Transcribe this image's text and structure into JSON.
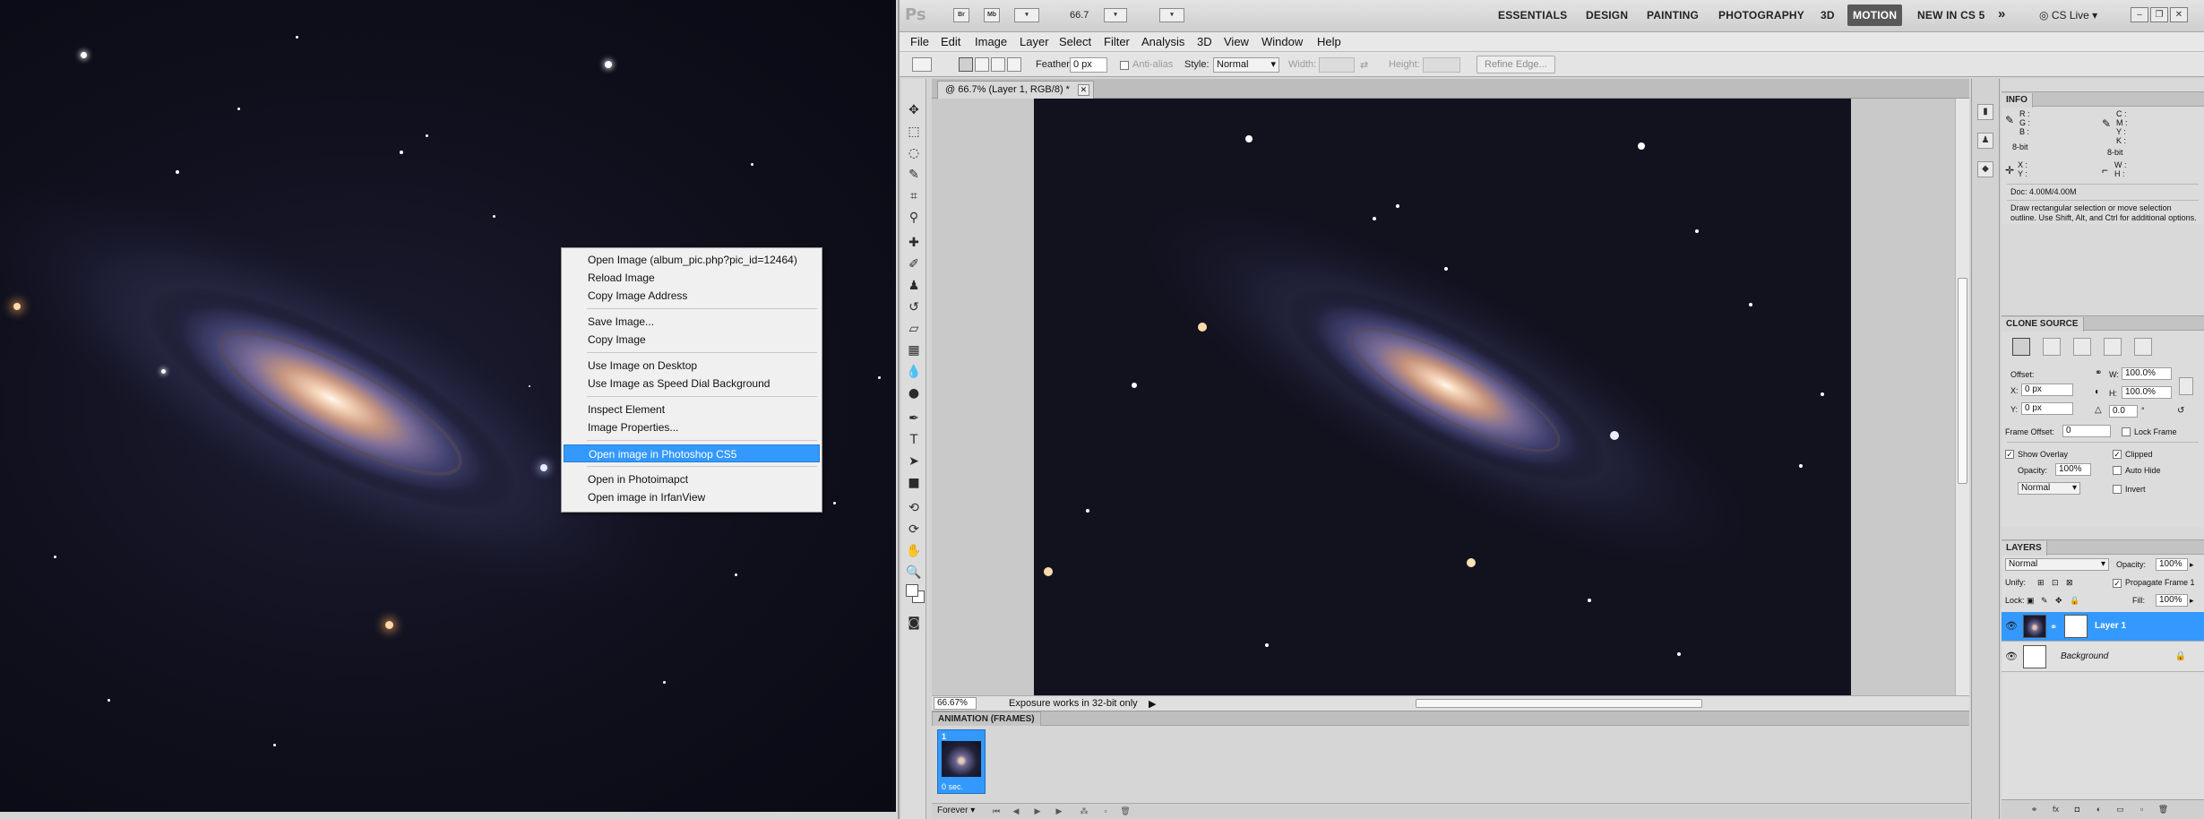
{
  "context_menu": {
    "items": [
      {
        "label": "Open Image (album_pic.php?pic_id=12464)",
        "highlighted": false,
        "sep_after": false
      },
      {
        "label": "Reload Image",
        "highlighted": false,
        "sep_after": false
      },
      {
        "label": "Copy Image Address",
        "highlighted": false,
        "sep_after": true
      },
      {
        "label": "Save Image...",
        "highlighted": false,
        "sep_after": false
      },
      {
        "label": "Copy Image",
        "highlighted": false,
        "sep_after": true
      },
      {
        "label": "Use Image on Desktop",
        "highlighted": false,
        "sep_after": false
      },
      {
        "label": "Use Image as Speed Dial Background",
        "highlighted": false,
        "sep_after": true
      },
      {
        "label": "Inspect Element",
        "highlighted": false,
        "sep_after": false
      },
      {
        "label": "Image Properties...",
        "highlighted": false,
        "sep_after": true
      },
      {
        "label": "Open image in Photoshop CS5",
        "highlighted": true,
        "sep_after": true
      },
      {
        "label": "Open in Photoimapct",
        "highlighted": false,
        "sep_after": false
      },
      {
        "label": "Open image in IrfanView",
        "highlighted": false,
        "sep_after": false
      }
    ]
  },
  "photoshop": {
    "logo": "Ps",
    "appbar_buttons": [
      "Br",
      "Mb"
    ],
    "zoom": "66.7",
    "workspaces": [
      {
        "label": "ESSENTIALS",
        "active": false
      },
      {
        "label": "DESIGN",
        "active": false
      },
      {
        "label": "PAINTING",
        "active": false
      },
      {
        "label": "PHOTOGRAPHY",
        "active": false
      },
      {
        "label": "3D",
        "active": false
      },
      {
        "label": "MOTION",
        "active": true
      },
      {
        "label": "NEW IN CS 5",
        "active": false
      }
    ],
    "workspace_more": "»",
    "cs_live": "CS Live",
    "window_controls": [
      "–",
      "❐",
      "✕"
    ],
    "menus": [
      "File",
      "Edit",
      "Image",
      "Layer",
      "Select",
      "Filter",
      "Analysis",
      "3D",
      "View",
      "Window",
      "Help"
    ],
    "options": {
      "feather_label": "Feather:",
      "feather_value": "0 px",
      "antialias_label": "Anti-alias",
      "style_label": "Style:",
      "style_value": "Normal",
      "width_label": "Width:",
      "height_label": "Height:",
      "refine_edge": "Refine Edge..."
    },
    "document": {
      "tab_title": "@ 66.7% (Layer 1, RGB/8) *",
      "zoom_status": "66.67%",
      "status_text": "Exposure works in 32-bit only"
    },
    "animation": {
      "title": "ANIMATION (FRAMES)",
      "frame_number": "1",
      "frame_delay": "0 sec.",
      "loop": "Forever"
    },
    "info_panel": {
      "title": "INFO",
      "rgb_labels": [
        "R :",
        "G :",
        "B :"
      ],
      "cmyk_labels": [
        "C :",
        "M :",
        "Y :",
        "K :"
      ],
      "bit_left": "8-bit",
      "bit_right": "8-bit",
      "xy_labels": [
        "X :",
        "Y :"
      ],
      "wh_labels": [
        "W :",
        "H :"
      ],
      "doc": "Doc: 4.00M/4.00M",
      "hint": "Draw rectangular selection or move selection outline. Use Shift, Alt, and Ctrl for additional options."
    },
    "clone_panel": {
      "title": "CLONE SOURCE",
      "offset_label": "Offset:",
      "x_label": "X:",
      "x_value": "0 px",
      "y_label": "Y:",
      "y_value": "0 px",
      "w_label": "W:",
      "w_value": "100.0%",
      "h_label": "H:",
      "h_value": "100.0%",
      "angle_value": "0.0",
      "angle_unit": "°",
      "frame_offset_label": "Frame Offset:",
      "frame_offset_value": "0",
      "lock_frame": "Lock Frame",
      "show_overlay": "Show Overlay",
      "clipped": "Clipped",
      "opacity_label": "Opacity:",
      "opacity_value": "100%",
      "auto_hide": "Auto Hide",
      "blend_value": "Normal",
      "invert": "Invert"
    },
    "layers_panel": {
      "title": "LAYERS",
      "blend_mode": "Normal",
      "opacity_label": "Opacity:",
      "opacity_value": "100%",
      "unify_label": "Unify:",
      "propagate": "Propagate Frame 1",
      "lock_label": "Lock:",
      "fill_label": "Fill:",
      "fill_value": "100%",
      "layers": [
        {
          "name": "Layer 1",
          "selected": true
        },
        {
          "name": "Background",
          "selected": false
        }
      ]
    }
  }
}
